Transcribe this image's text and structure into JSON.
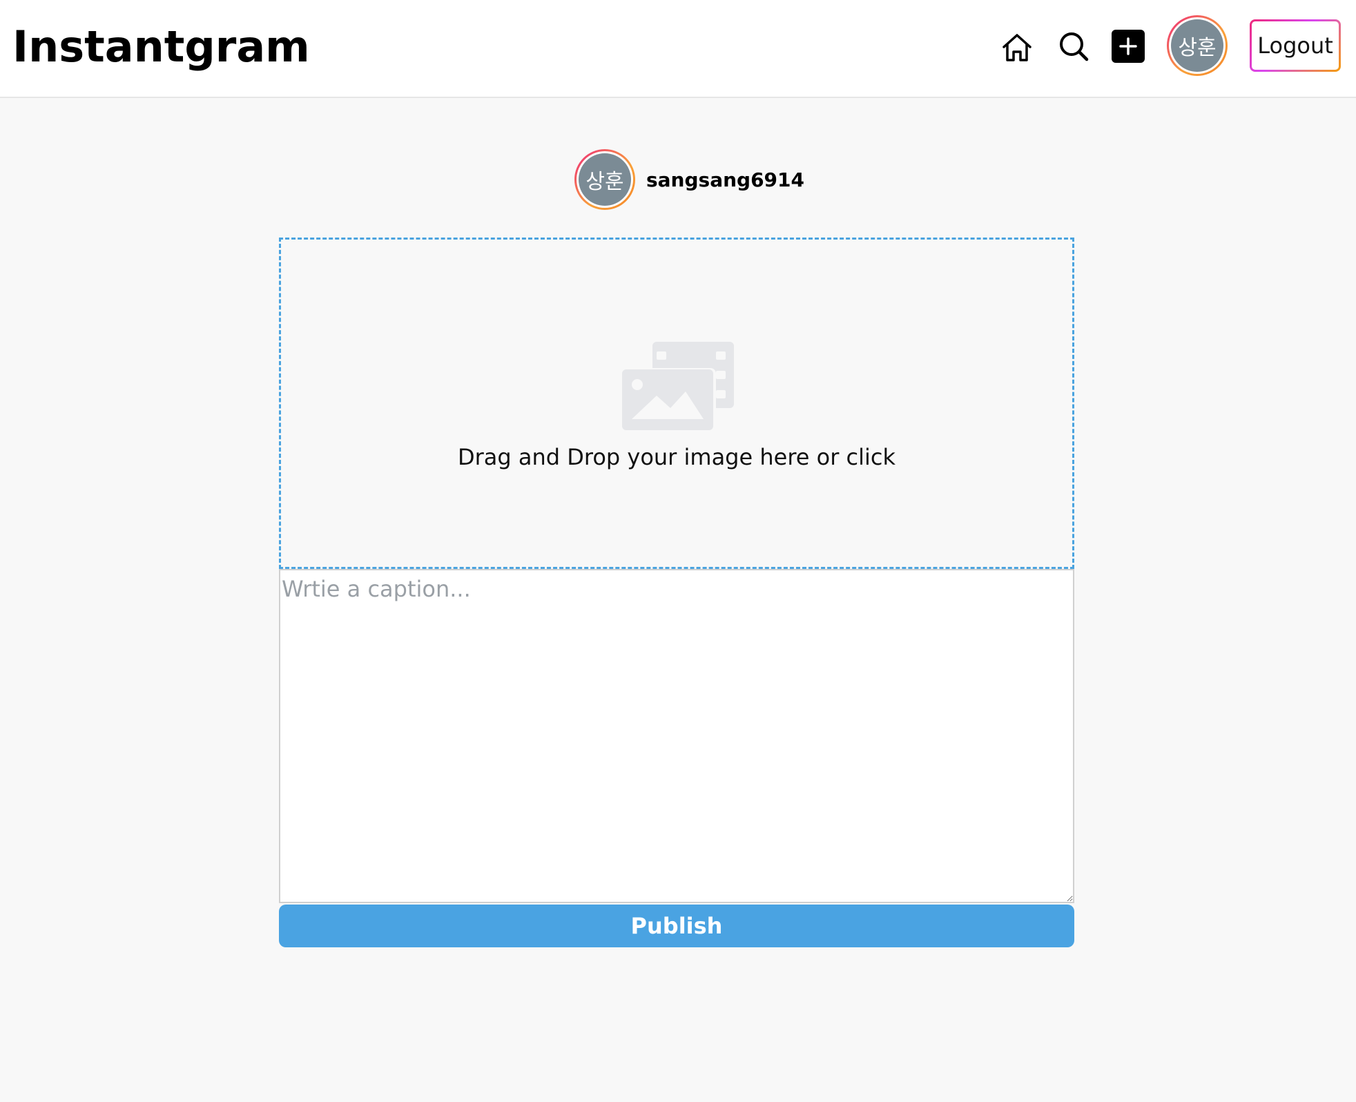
{
  "app": {
    "title": "Instantgram"
  },
  "nav": {
    "home_icon": "home-icon",
    "search_icon": "search-icon",
    "create_icon": "plus-square-icon",
    "avatar_text": "상훈",
    "logout_label": "Logout"
  },
  "composer": {
    "author": {
      "avatar_text": "상훈",
      "username": "sangsang6914"
    },
    "dropzone": {
      "icon": "photo-video-icon",
      "text": "Drag and Drop your image here or click"
    },
    "caption": {
      "placeholder": "Wrtie a caption...",
      "value": ""
    },
    "publish_label": "Publish"
  },
  "colors": {
    "accent_blue": "#4aa3e2",
    "dropzone_border": "#4aa3df",
    "avatar_fill": "#7b8b95",
    "gradient_pink": "#ee2a7b",
    "gradient_orange": "#f59e0b"
  }
}
